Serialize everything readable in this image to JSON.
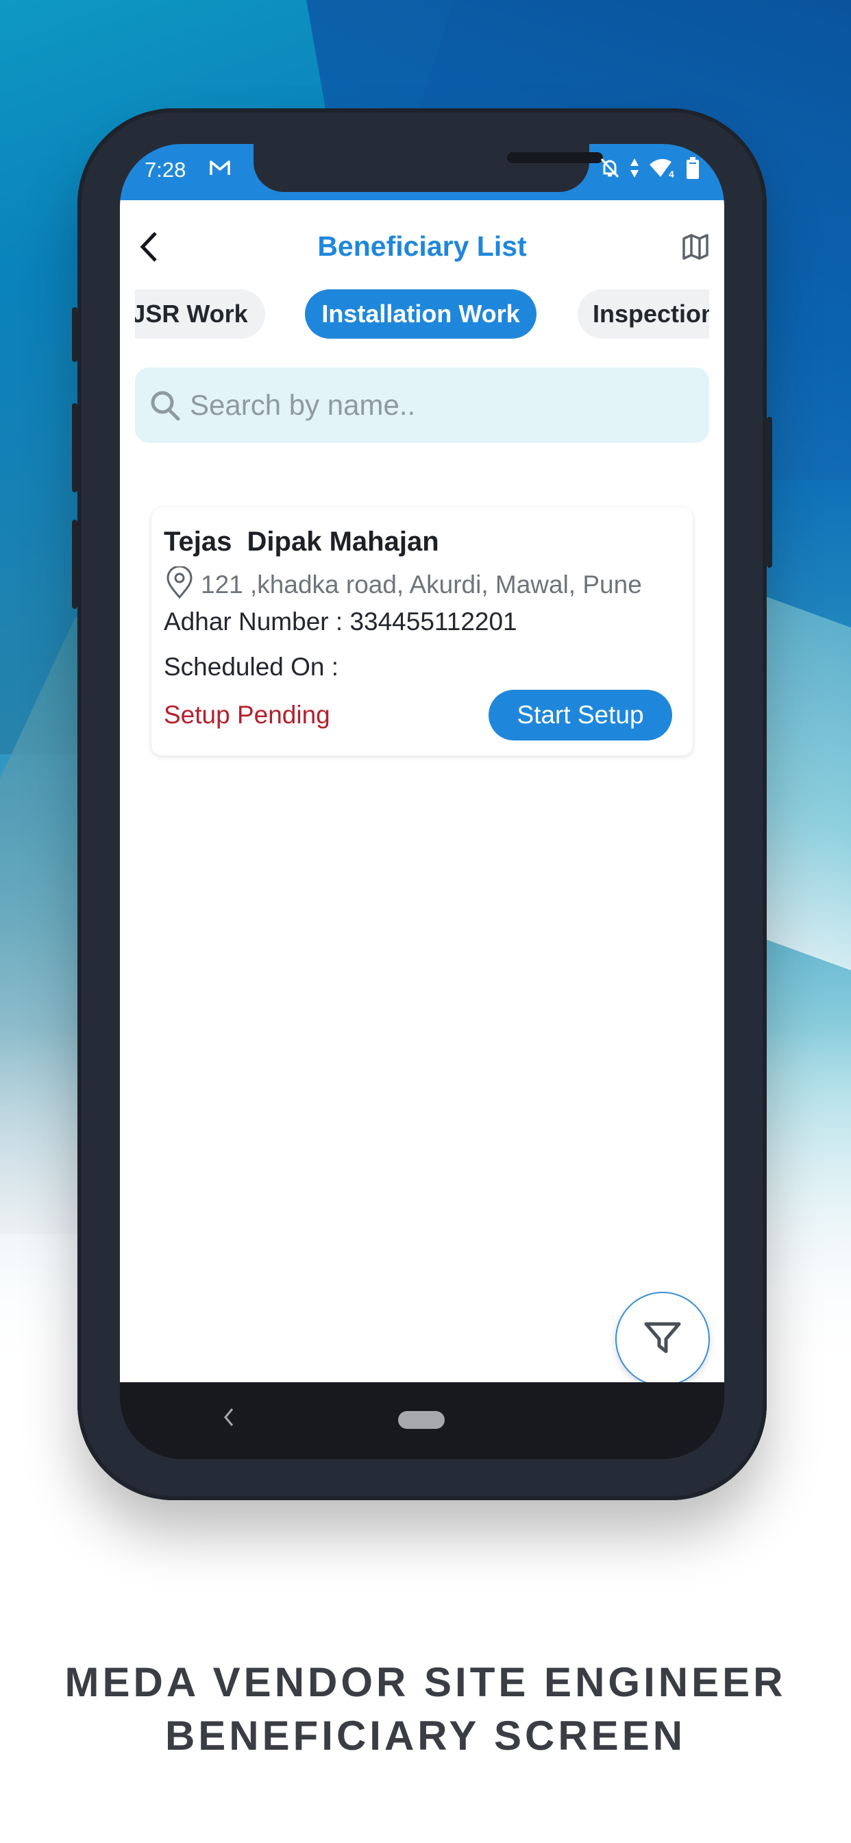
{
  "status_bar": {
    "time": "7:28",
    "mail_icon": "gmail-icon",
    "icons": [
      "notifications-off-icon",
      "data-arrows-icon",
      "wifi-icon",
      "battery-icon"
    ],
    "wifi_badge": "4"
  },
  "header": {
    "title": "Beneficiary List",
    "back_icon": "chevron-left-icon",
    "map_icon": "map-icon"
  },
  "tabs": [
    {
      "label": "JSR Work",
      "active": false
    },
    {
      "label": "Installation Work",
      "active": true
    },
    {
      "label": "Inspection",
      "active": false
    }
  ],
  "search": {
    "placeholder": "Search by name..",
    "value": ""
  },
  "beneficiaries": [
    {
      "name": "Tejas  Dipak Mahajan",
      "address": "121 ,khadka road, Akurdi, Mawal, Pune",
      "adhar_label": "Adhar Number : 334455112201",
      "scheduled_label": "Scheduled On :",
      "status": "Setup Pending",
      "action_label": "Start Setup"
    }
  ],
  "fab": {
    "icon": "filter-icon"
  },
  "caption": {
    "line1": "MEDA VENDOR SITE ENGINEER",
    "line2": "BENEFICIARY SCREEN"
  },
  "colors": {
    "primary": "#1f87db",
    "status_pending": "#b3202e",
    "search_bg": "#e2f4f8"
  }
}
